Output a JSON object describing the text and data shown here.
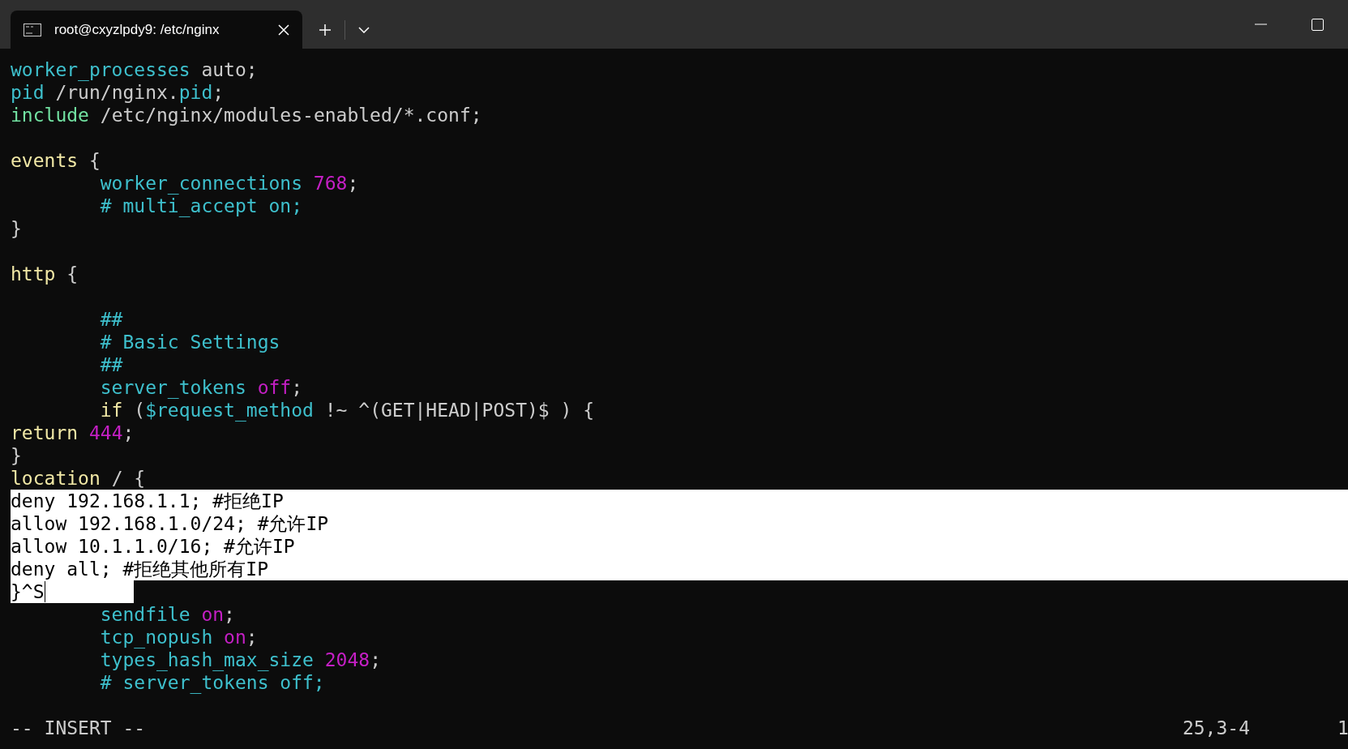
{
  "tab": {
    "title": "root@cxyzlpdy9: /etc/nginx",
    "selected": true
  },
  "lines": [
    {
      "indented": false,
      "selected": false,
      "cursor": false,
      "segments": [
        {
          "text": "worker_processes",
          "kind": "directive"
        },
        {
          "text": " auto;",
          "kind": "plain"
        }
      ]
    },
    {
      "indented": false,
      "selected": false,
      "cursor": false,
      "segments": [
        {
          "text": "pid",
          "kind": "directive"
        },
        {
          "text": " /run/nginx.",
          "kind": "plain"
        },
        {
          "text": "pid",
          "kind": "directive"
        },
        {
          "text": ";",
          "kind": "plain"
        }
      ]
    },
    {
      "indented": false,
      "selected": false,
      "cursor": false,
      "segments": [
        {
          "text": "include",
          "kind": "include"
        },
        {
          "text": " /etc/nginx/modules-enabled/*.conf;",
          "kind": "plain"
        }
      ]
    },
    {
      "selected": false,
      "cursor": false
    },
    {
      "indented": false,
      "selected": false,
      "cursor": false,
      "segments": [
        {
          "text": "events",
          "kind": "block"
        },
        {
          "text": " {",
          "kind": "plain"
        }
      ]
    },
    {
      "indented": true,
      "selected": false,
      "cursor": false,
      "segments": [
        {
          "text": "worker_connections",
          "kind": "directive"
        },
        {
          "text": " 768",
          "kind": "number"
        },
        {
          "text": ";",
          "kind": "plain"
        }
      ]
    },
    {
      "indented": true,
      "selected": false,
      "cursor": false,
      "segments": [
        {
          "text": "# multi_accept on;",
          "kind": "comment"
        }
      ]
    },
    {
      "indented": false,
      "selected": false,
      "cursor": false,
      "segments": [
        {
          "text": "}",
          "kind": "plain"
        }
      ]
    },
    {
      "selected": false,
      "cursor": false
    },
    {
      "indented": false,
      "selected": false,
      "cursor": false,
      "segments": [
        {
          "text": "http",
          "kind": "block"
        },
        {
          "text": " {",
          "kind": "plain"
        }
      ]
    },
    {
      "selected": false,
      "cursor": false
    },
    {
      "indented": true,
      "selected": false,
      "cursor": false,
      "segments": [
        {
          "text": "##",
          "kind": "comment"
        }
      ]
    },
    {
      "indented": true,
      "selected": false,
      "cursor": false,
      "segments": [
        {
          "text": "# Basic Settings",
          "kind": "comment"
        }
      ]
    },
    {
      "indented": true,
      "selected": false,
      "cursor": false,
      "segments": [
        {
          "text": "##",
          "kind": "comment"
        }
      ]
    },
    {
      "indented": true,
      "selected": false,
      "cursor": false,
      "segments": [
        {
          "text": "server_tokens",
          "kind": "directive"
        },
        {
          "text": " off",
          "kind": "number"
        },
        {
          "text": ";",
          "kind": "plain"
        }
      ]
    },
    {
      "indented": true,
      "selected": false,
      "cursor": false,
      "segments": [
        {
          "text": "if",
          "kind": "block"
        },
        {
          "text": " (",
          "kind": "plain"
        },
        {
          "text": "$request_method",
          "kind": "directive"
        },
        {
          "text": " !~ ^(GET|HEAD|POST)$ ) {",
          "kind": "plain"
        }
      ]
    },
    {
      "indented": false,
      "selected": false,
      "cursor": false,
      "segments": [
        {
          "text": "return",
          "kind": "block"
        },
        {
          "text": " 444",
          "kind": "number"
        },
        {
          "text": ";",
          "kind": "plain"
        }
      ]
    },
    {
      "indented": false,
      "selected": false,
      "cursor": false,
      "segments": [
        {
          "text": "}",
          "kind": "plain"
        }
      ]
    },
    {
      "indented": false,
      "selected": false,
      "cursor": false,
      "segments": [
        {
          "text": "location",
          "kind": "block"
        },
        {
          "text": " / {",
          "kind": "plain"
        }
      ]
    },
    {
      "indented": false,
      "selected": true,
      "cursor": false,
      "segments": [
        {
          "text": "deny 192.168.1.1; #拒绝IP",
          "kind": "plain"
        }
      ]
    },
    {
      "indented": false,
      "selected": true,
      "cursor": false,
      "segments": [
        {
          "text": "allow 192.168.1.0/24; #允许IP",
          "kind": "plain"
        }
      ]
    },
    {
      "indented": false,
      "selected": true,
      "cursor": false,
      "segments": [
        {
          "text": "allow 10.1.1.0/16; #允许IP",
          "kind": "plain"
        }
      ]
    },
    {
      "indented": false,
      "selected": true,
      "cursor": false,
      "segments": [
        {
          "text": "deny all; #拒绝其他所有IP",
          "kind": "plain"
        }
      ]
    },
    {
      "indented": false,
      "selected": true,
      "cursor": true,
      "segments": [
        {
          "text": "}^S",
          "kind": "plain"
        }
      ]
    },
    {
      "indented": true,
      "selected": false,
      "cursor": false,
      "segments": [
        {
          "text": "sendfile",
          "kind": "directive"
        },
        {
          "text": " on",
          "kind": "number"
        },
        {
          "text": ";",
          "kind": "plain"
        }
      ]
    },
    {
      "indented": true,
      "selected": false,
      "cursor": false,
      "segments": [
        {
          "text": "tcp_nopush",
          "kind": "directive"
        },
        {
          "text": " on",
          "kind": "number"
        },
        {
          "text": ";",
          "kind": "plain"
        }
      ]
    },
    {
      "indented": true,
      "selected": false,
      "cursor": false,
      "segments": [
        {
          "text": "types_hash_max_size",
          "kind": "directive"
        },
        {
          "text": " 2048",
          "kind": "number"
        },
        {
          "text": ";",
          "kind": "plain"
        }
      ]
    },
    {
      "indented": true,
      "selected": false,
      "cursor": false,
      "segments": [
        {
          "text": "# server_tokens off;",
          "kind": "comment"
        }
      ]
    },
    {
      "selected": false,
      "cursor": false
    }
  ],
  "status_bar": {
    "mode": "-- INSERT --",
    "position": "25,3-4",
    "scroll": "1"
  }
}
